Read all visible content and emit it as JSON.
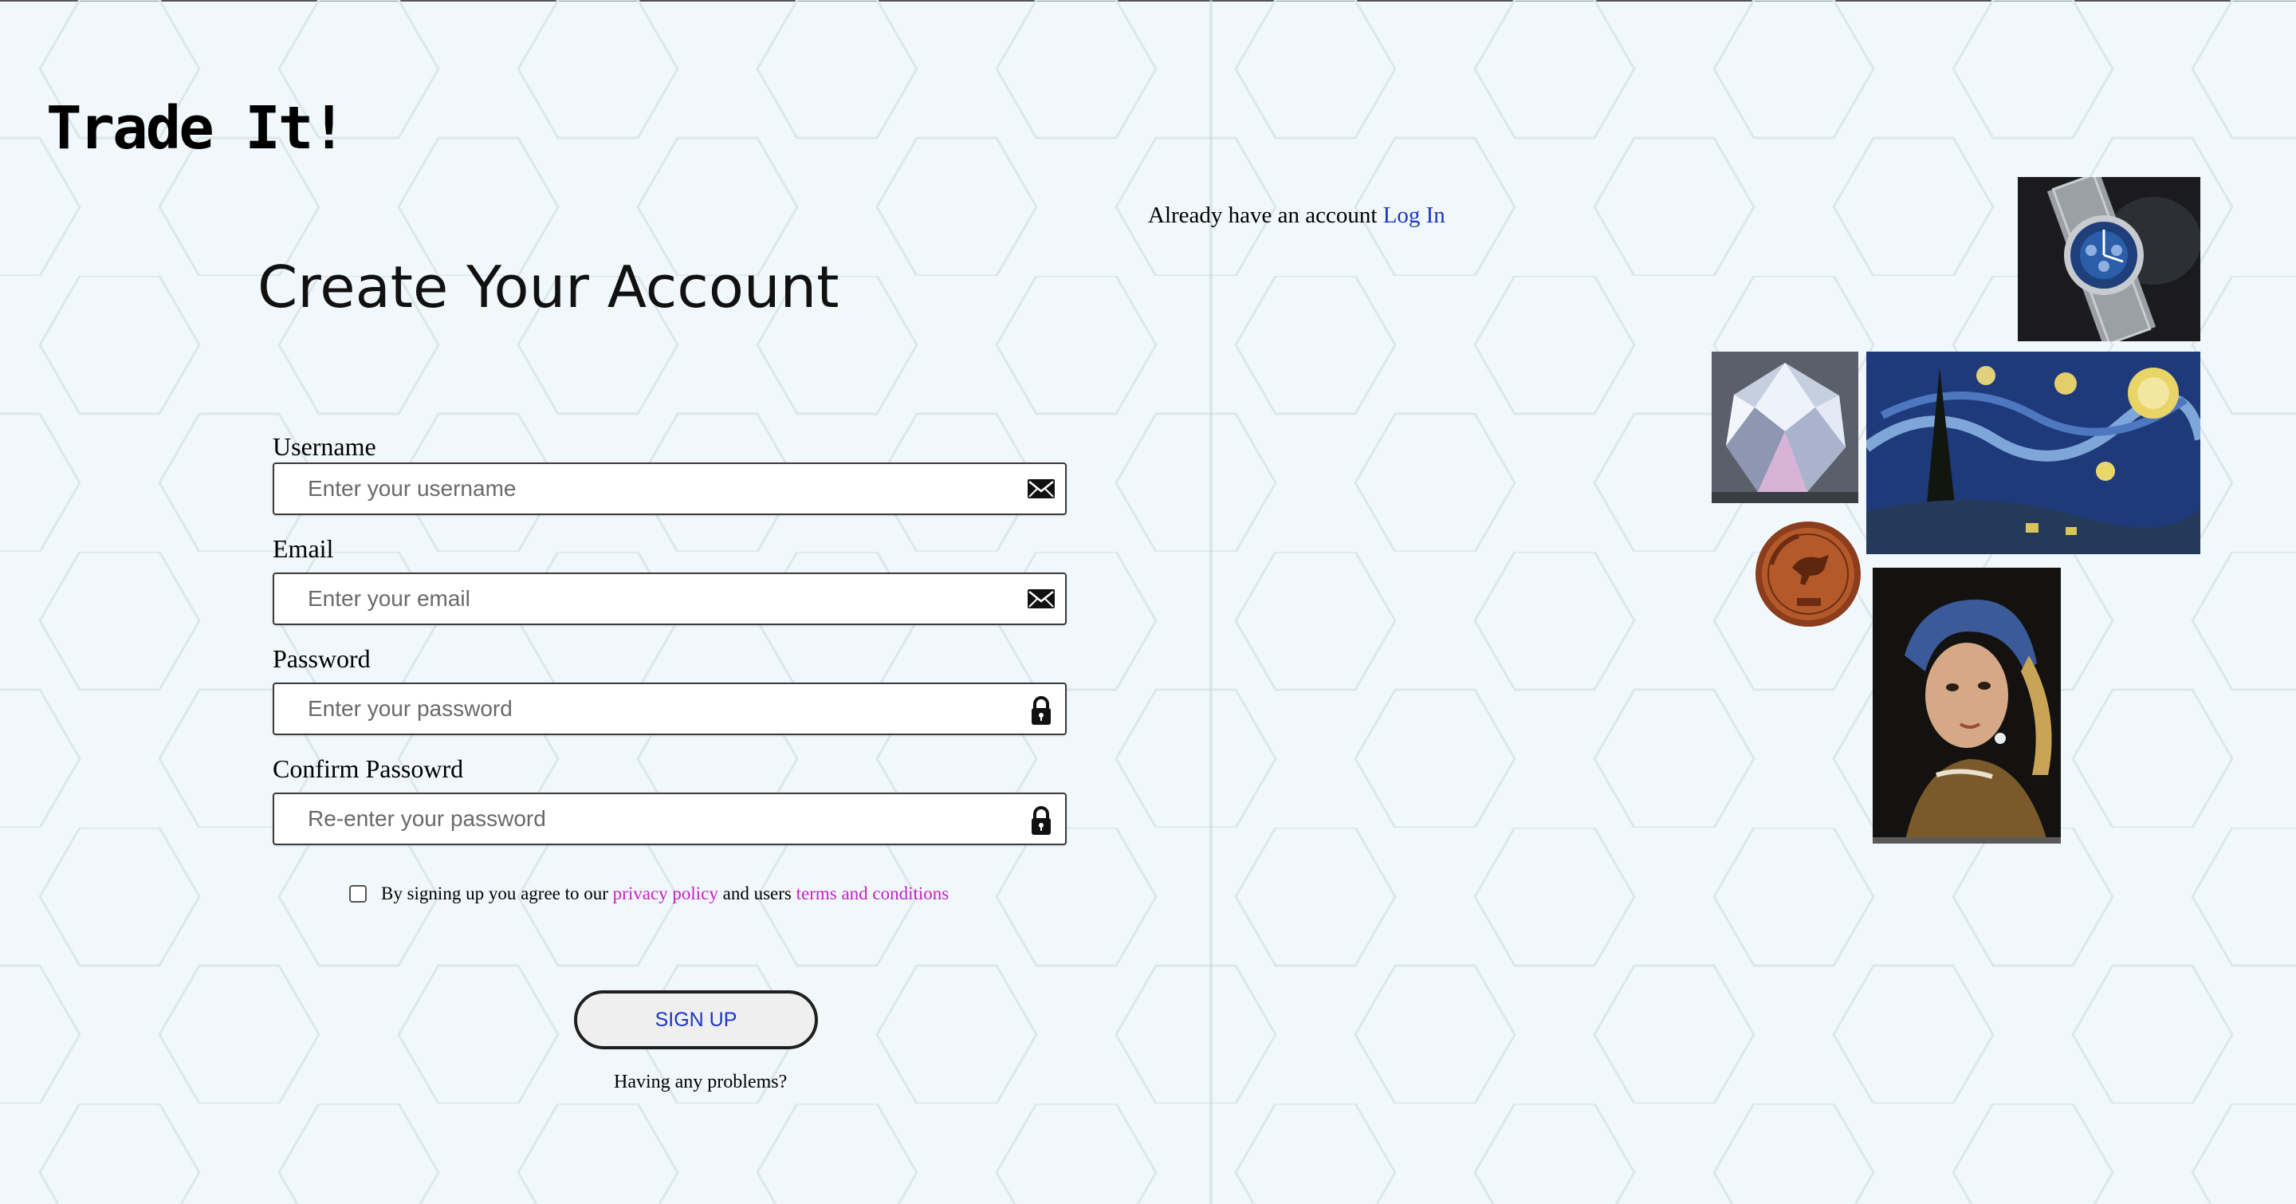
{
  "brand": {
    "name": "Trade It!"
  },
  "form": {
    "title": "Create Your Account",
    "fields": [
      {
        "label": "Username",
        "placeholder": "Enter your username",
        "value": "",
        "icon": "envelope-icon"
      },
      {
        "label": "Email",
        "placeholder": "Enter your email",
        "value": "",
        "icon": "envelope-icon"
      },
      {
        "label": "Password",
        "placeholder": "Enter your password",
        "value": "",
        "icon": "lock-icon"
      },
      {
        "label": "Confirm Passowrd",
        "placeholder": "Re-enter your password",
        "value": "",
        "icon": "lock-icon"
      }
    ],
    "agreement": {
      "checked": false,
      "prefix": "By signing up you agree to our",
      "privacy_link": "privacy policy",
      "middle": "and users",
      "terms_link": "terms and conditions"
    },
    "submit_label": "SIGN UP",
    "help_text": "Having any problems?"
  },
  "login_prompt": {
    "text": "Already have an account",
    "link": "Log In"
  },
  "gallery": [
    {
      "name": "wristwatch-image"
    },
    {
      "name": "diamond-image"
    },
    {
      "name": "starry-night-painting-image"
    },
    {
      "name": "coin-image"
    },
    {
      "name": "girl-with-pearl-earring-painting-image"
    }
  ],
  "colors": {
    "background": "#f1f8fb",
    "link_blue": "#1a35c8",
    "link_magenta": "#c81ec8",
    "hex_pattern": "#dce6ec"
  }
}
